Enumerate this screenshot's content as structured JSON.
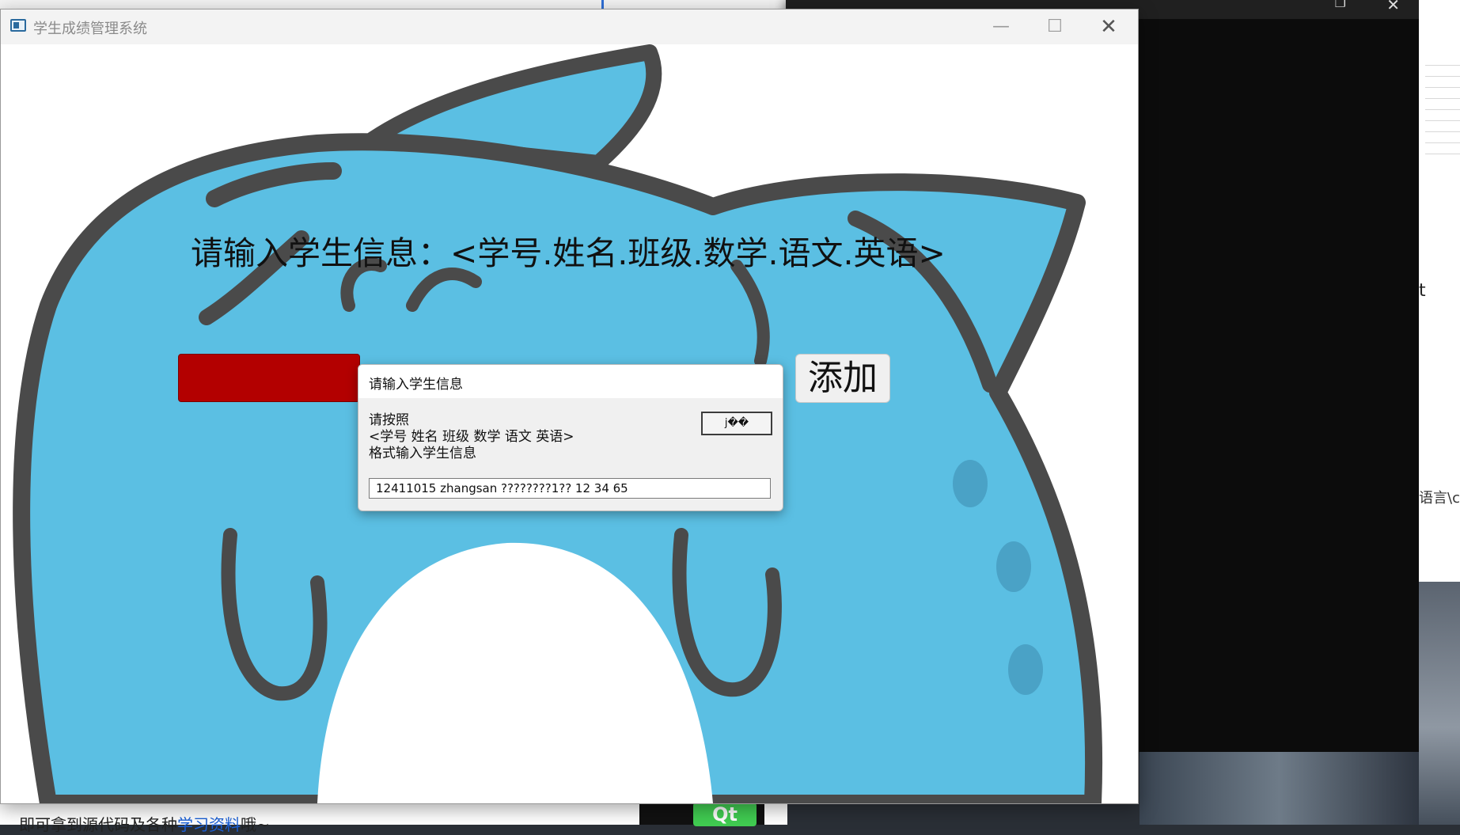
{
  "window": {
    "title": "学生成绩管理系统",
    "minimize_glyph": "—",
    "maximize_glyph": "☐",
    "close_glyph": "✕"
  },
  "main": {
    "instruction": "请输入学生信息：<学号.姓名.班级.数学.语文.英语>",
    "add_button_label": "添加"
  },
  "dialog": {
    "title": "请输入学生信息",
    "prompt_line1": "请按照",
    "prompt_line2": "<学号 姓名 班级 数学 语文 英语>",
    "prompt_line3": "格式输入学生信息",
    "ok_label": "j��",
    "input_value": "12411015 zhangsan ????????1?? 12 34 65"
  },
  "background": {
    "bottom_text": "即可拿到源代码及各种",
    "bottom_link": "学习资料",
    "bottom_suffix": "哦~",
    "right_text_t": "t",
    "right_text_yu": "语言\\c",
    "qt_logo": "Qt",
    "terminal_close": "✕",
    "terminal_max": "❐"
  },
  "colors": {
    "mascot_blue": "#5bbfe3",
    "mascot_outline": "#4a4a4a",
    "red_input": "#b30000",
    "qt_green": "#41cd52"
  }
}
